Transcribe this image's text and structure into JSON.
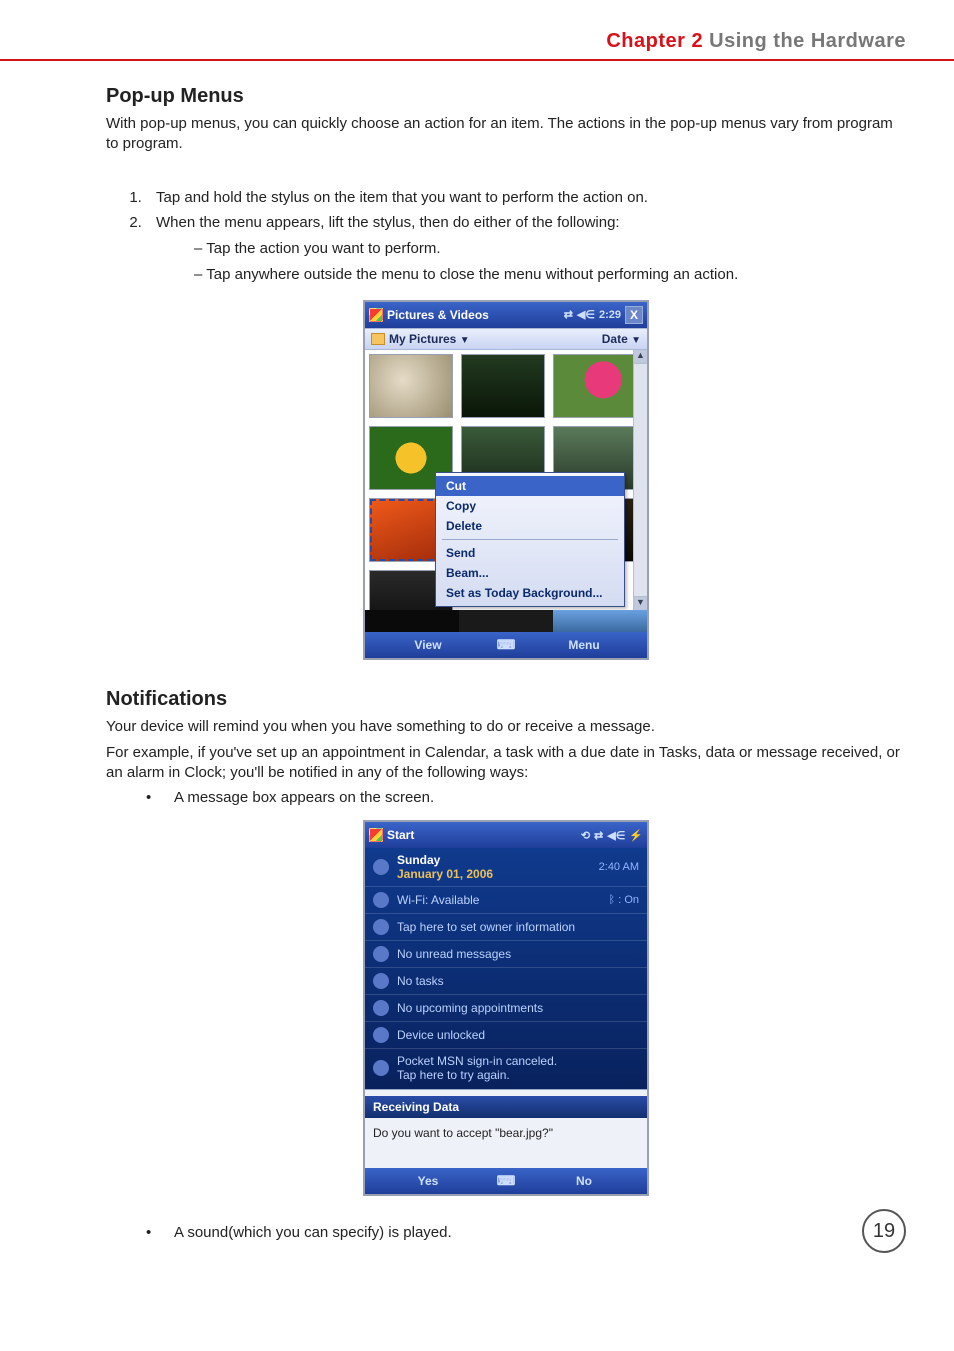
{
  "chapter": {
    "red": "Chapter 2",
    "grey": "  Using the Hardware"
  },
  "popup_section": {
    "title": "Pop-up Menus",
    "intro": "With pop-up menus, you can quickly choose an action for an item. The actions in the pop-up menus vary from program to program.",
    "step1": "Tap and hold the stylus on the item that you want to perform the action on.",
    "step2": "When the menu appears, lift the stylus, then do either of the following:",
    "step2a": "Tap the action you want to perform.",
    "step2b": "Tap anywhere outside the menu to close the menu without performing an action."
  },
  "fig1": {
    "app_title": "Pictures & Videos",
    "time": "2:29",
    "close": "X",
    "folder": "My Pictures",
    "sort": "Date",
    "menu": {
      "cut": "Cut",
      "copy": "Copy",
      "delete": "Delete",
      "send": "Send",
      "beam": "Beam...",
      "setbg": "Set as Today Background..."
    },
    "sk_left": "View",
    "sk_right": "Menu"
  },
  "notif_section": {
    "title": "Notifications",
    "p1": "Your device will remind you when you have something to do or receive a message.",
    "p2": "For example, if you've set up an appointment in Calendar, a task with a due date in Tasks, data or message received, or an alarm in Clock; you'll be notified in any of the following ways:",
    "b1": "A message box appears on the screen.",
    "b2": "A sound(which you can specify) is played."
  },
  "fig2": {
    "app_title": "Start",
    "day": "Sunday",
    "date": "January 01, 2006",
    "clock": "2:40 AM",
    "wifi": "Wi-Fi: Available",
    "bt": ": On",
    "owner": "Tap here to set owner information",
    "mail": "No unread messages",
    "tasks": "No tasks",
    "cal": "No upcoming appointments",
    "lock": "Device unlocked",
    "msn1": "Pocket MSN sign-in canceled.",
    "msn2": "Tap here to try again.",
    "recv_hdr": "Receiving Data",
    "recv_body": "Do you want to accept \"bear.jpg?\"",
    "sk_left": "Yes",
    "sk_right": "No"
  },
  "page_number": "19"
}
